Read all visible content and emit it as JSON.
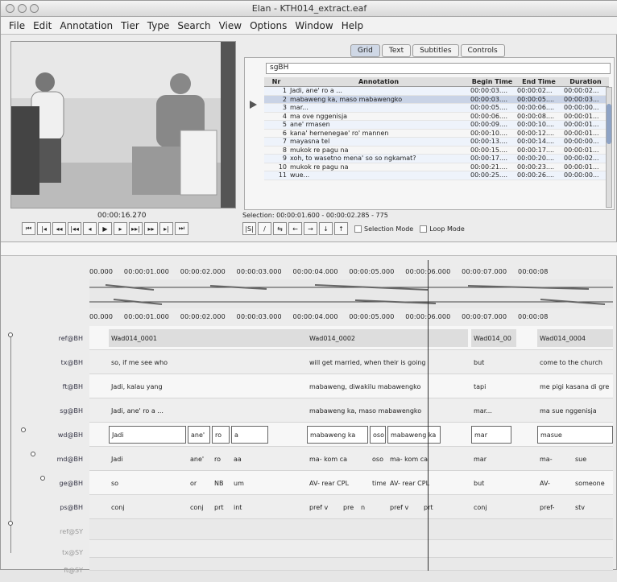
{
  "window": {
    "title": "Elan - KTH014_extract.eaf"
  },
  "menubar": [
    "File",
    "Edit",
    "Annotation",
    "Tier",
    "Type",
    "Search",
    "View",
    "Options",
    "Window",
    "Help"
  ],
  "video": {
    "time": "00:00:16.270"
  },
  "tabs": [
    "Grid",
    "Text",
    "Subtitles",
    "Controls"
  ],
  "tier_select": "sgBH",
  "table": {
    "headers": [
      "Nr",
      "Annotation",
      "Begin Time",
      "End Time",
      "Duration"
    ],
    "rows": [
      [
        "1",
        "Jadi, ane' ro a ...",
        "00:00:03....",
        "00:00:02...",
        "00:00:02..."
      ],
      [
        "2",
        "mabaweng ka, maso mabawengko",
        "00:00:03....",
        "00:00:05....",
        "00:00:03..."
      ],
      [
        "3",
        "mar...",
        "00:00:05....",
        "00:00:06....",
        "00:00:00..."
      ],
      [
        "4",
        "ma ove nggenisja",
        "00:00:06....",
        "00:00:08....",
        "00:00:01..."
      ],
      [
        "5",
        "ane' rmasen",
        "00:00:09....",
        "00:00:10....",
        "00:00:01..."
      ],
      [
        "6",
        "kana' hernenegae' ro' mannen",
        "00:00:10....",
        "00:00:12....",
        "00:00:01..."
      ],
      [
        "7",
        "mayasna tel",
        "00:00:13....",
        "00:00:14....",
        "00:00:00..."
      ],
      [
        "8",
        "mukok re pagu na",
        "00:00:15....",
        "00:00:17....",
        "00:00:01..."
      ],
      [
        "9",
        "xoh, to wasetno mena' so so ngkamat?",
        "00:00:17....",
        "00:00:20....",
        "00:00:02..."
      ],
      [
        "10",
        "mukok re pagu na",
        "00:00:21....",
        "00:00:23....",
        "00:00:01..."
      ],
      [
        "11",
        "wue...",
        "00:00:25....",
        "00:00:26....",
        "00:00:00..."
      ]
    ]
  },
  "selection": {
    "text": "Selection: 00:00:01.600 - 00:00:02.285 - 775"
  },
  "checkboxes": [
    "Selection Mode",
    "Loop Mode"
  ],
  "ruler_labels": [
    "00.000",
    "00:00:01.000",
    "00:00:02.000",
    "00:00:03.000",
    "00:00:04.000",
    "00:00:05.000",
    "00:00:06.000",
    "00:00:07.000",
    "00:00:08"
  ],
  "tier_labels": [
    "ref@BH",
    "tx@BH",
    "ft@BH",
    "sg@BH",
    "wd@BH",
    "md@BH",
    "ge@BH",
    "ps@BH",
    "ref@SY",
    "tx@SY",
    "ft@SY"
  ],
  "tiers": [
    [
      "Wad014_0001",
      "Wad014_0002",
      "Wad014_00",
      "Wad014_0004"
    ],
    [
      "so, if me see who",
      "will get married, when their is going",
      "but",
      "come to the church"
    ],
    [
      "Jadi, kalau yang",
      "mabaweng, diwakilu mabawengko",
      "tapi",
      "me pigi kasana di gre"
    ],
    [
      "Jadi, ane' ro a ...",
      "mabaweng ka, maso mabawengko",
      "mar...",
      "ma sue nggenisja"
    ],
    [
      "Jadi",
      "ane'",
      "ro",
      "a",
      "mabaweng ka",
      "oso",
      "mabaweng ka",
      "mar",
      "masue"
    ],
    [
      "Jadi",
      "ane'",
      "ro",
      "aa",
      "ma- kom ca",
      "oso",
      "ma- kom ca",
      "mar",
      "ma-",
      "sue"
    ],
    [
      "so",
      "or",
      "NB",
      "um",
      "AV- rear CPL",
      "time",
      "AV- rear CPL",
      "but",
      "AV-",
      "someone"
    ],
    [
      "conj",
      "conj",
      "prt",
      "int",
      "pref v",
      "pre",
      "n",
      "pref v",
      "prt",
      "conj",
      "pref-",
      "stv"
    ]
  ]
}
